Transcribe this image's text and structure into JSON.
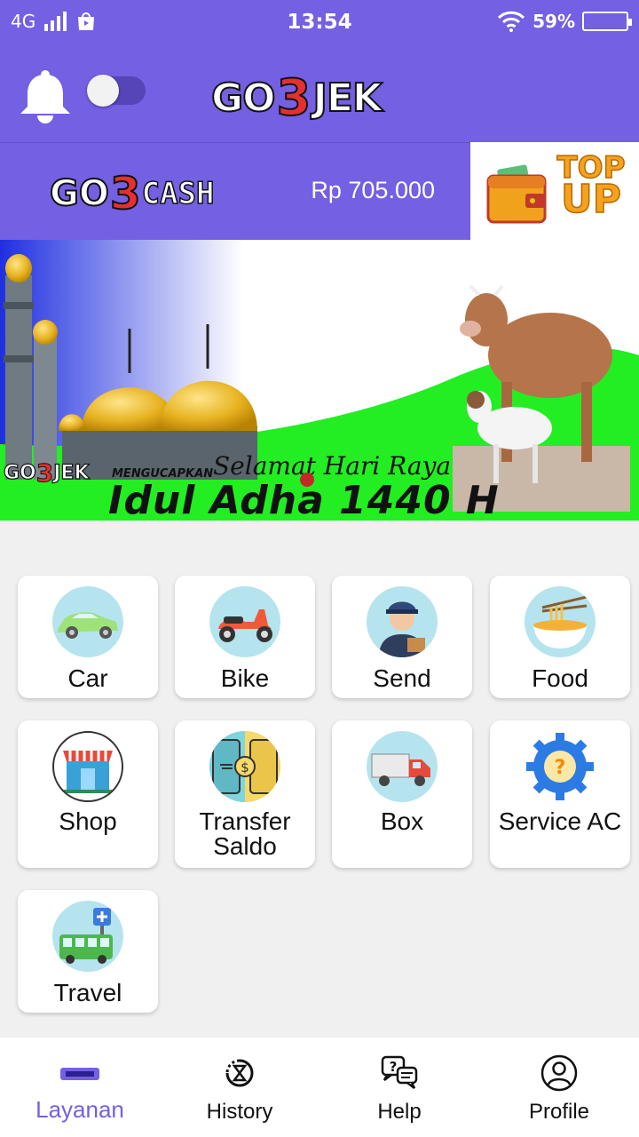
{
  "status_bar": {
    "network": "4G",
    "time": "13:54",
    "battery": "59%",
    "icons": [
      "signal-icon",
      "store-icon",
      "wifi-icon",
      "battery-icon"
    ]
  },
  "header": {
    "logo": {
      "go": "GO",
      "num": "3",
      "jek": "JEK"
    },
    "toggle_on": false,
    "colors": {
      "primary": "#7460e2",
      "logo_red": "#e53030"
    }
  },
  "cash": {
    "logo": {
      "go": "GO",
      "num": "3",
      "word": "CASH"
    },
    "balance": "Rp 705.000",
    "topup_line1": "TOP",
    "topup_line2": "UP"
  },
  "banner": {
    "brand": {
      "go": "GO",
      "num": "3",
      "jek": "JEK"
    },
    "mengucapkan": "MENGUCAPKAN",
    "greeting": "Selamat Hari Raya",
    "title": "Idul Adha 1440 H"
  },
  "services": [
    {
      "label": "Car",
      "icon": "car-icon"
    },
    {
      "label": "Bike",
      "icon": "scooter-icon"
    },
    {
      "label": "Send",
      "icon": "courier-icon"
    },
    {
      "label": "Food",
      "icon": "noodle-bowl-icon"
    },
    {
      "label": "Shop",
      "icon": "shop-icon"
    },
    {
      "label_line1": "Transfer",
      "label_line2": "Saldo",
      "icon": "transfer-money-icon"
    },
    {
      "label": "Box",
      "icon": "truck-icon"
    },
    {
      "label": "Service AC",
      "icon": "gear-question-icon"
    },
    {
      "label": "Travel",
      "icon": "bus-icon"
    }
  ],
  "bottom_nav": [
    {
      "label": "Layanan",
      "icon": "go3jek-logo-icon",
      "active": true
    },
    {
      "label": "History",
      "icon": "history-icon"
    },
    {
      "label": "Help",
      "icon": "help-chat-icon"
    },
    {
      "label": "Profile",
      "icon": "profile-icon"
    }
  ]
}
